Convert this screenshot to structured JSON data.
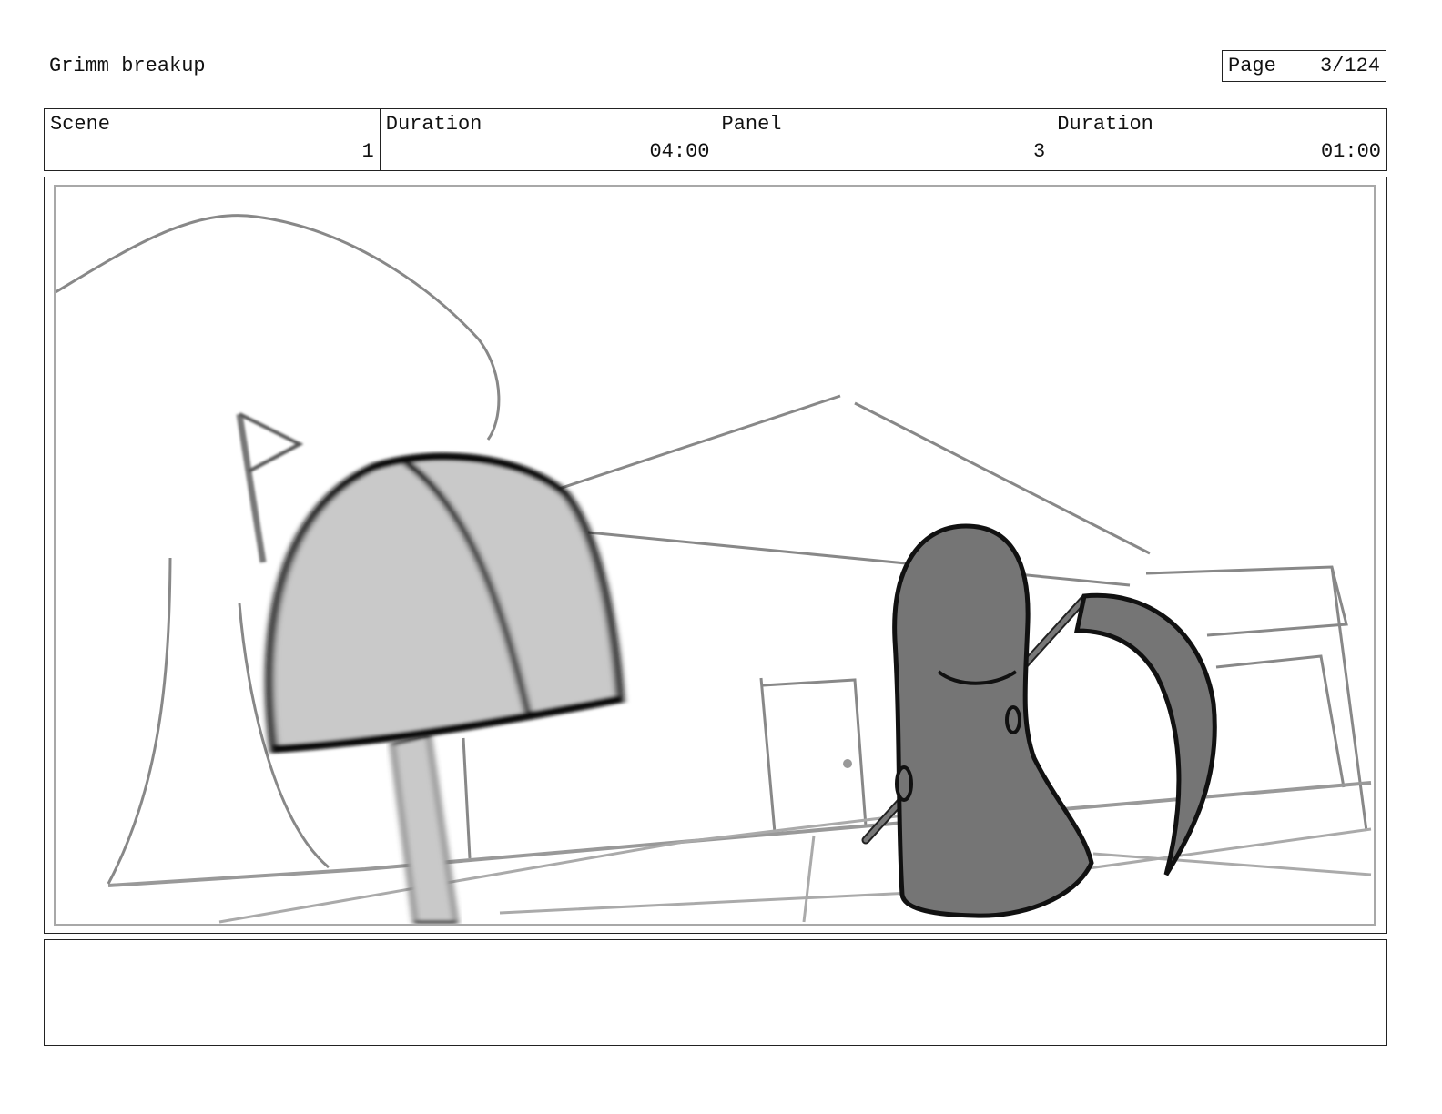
{
  "header": {
    "title": "Grimm breakup",
    "page_label": "Page",
    "page_value": "3/124"
  },
  "info": {
    "scene_label": "Scene",
    "scene_value": "1",
    "scene_duration_label": "Duration",
    "scene_duration_value": "04:00",
    "panel_label": "Panel",
    "panel_value": "3",
    "panel_duration_label": "Duration",
    "panel_duration_value": "01:00"
  },
  "notes": {
    "text": ""
  },
  "colors": {
    "line": "#222222",
    "sketch": "#8a8a8a",
    "mailbox_fill": "#c9c9c9",
    "reaper_fill": "#757575"
  }
}
